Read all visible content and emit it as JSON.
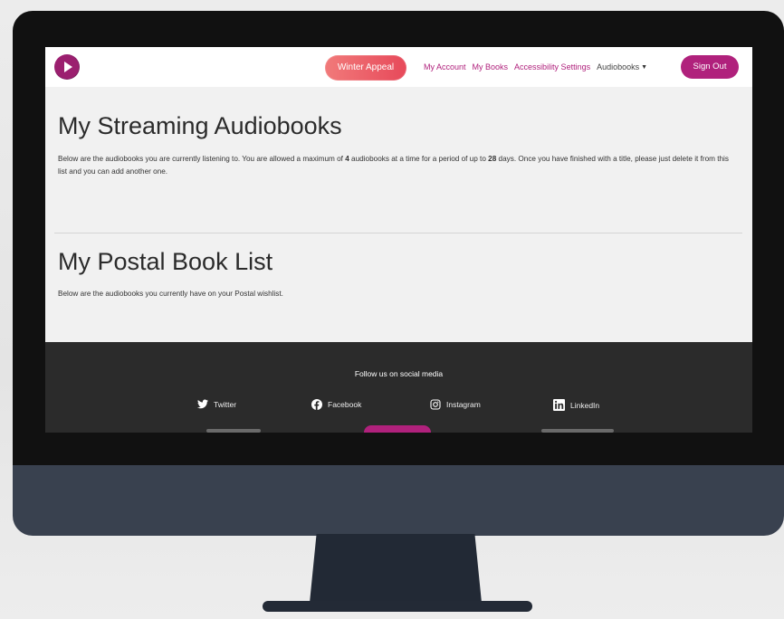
{
  "header": {
    "appeal_label": "Winter Appeal",
    "links": [
      "My Account",
      "My Books",
      "Accessibility Settings"
    ],
    "dropdown_label": "Audiobooks",
    "signout_label": "Sign Out"
  },
  "streaming": {
    "title": "My Streaming Audiobooks",
    "text_before_max": "Below are the audiobooks you are currently listening to. You are allowed a maximum of ",
    "max_count": "4",
    "text_between": " audiobooks at a time for a period of up to ",
    "max_days": "28",
    "text_after_days": " days. Once you have finished with a title, please just delete it from this list and you can add another one."
  },
  "postal": {
    "title": "My Postal Book List",
    "text": "Below are the audiobooks you currently have on your Postal wishlist."
  },
  "footer": {
    "follow_text": "Follow us on social media",
    "socials": [
      {
        "label": "Twitter",
        "icon": "twitter-icon"
      },
      {
        "label": "Facebook",
        "icon": "facebook-icon"
      },
      {
        "label": "Instagram",
        "icon": "instagram-icon"
      },
      {
        "label": "LinkedIn",
        "icon": "linkedin-icon"
      }
    ]
  },
  "colors": {
    "brand": "#b0217c",
    "appeal": "#e7495a",
    "footer_bg": "#2b2b2b",
    "monitor_chin": "#39414f"
  }
}
